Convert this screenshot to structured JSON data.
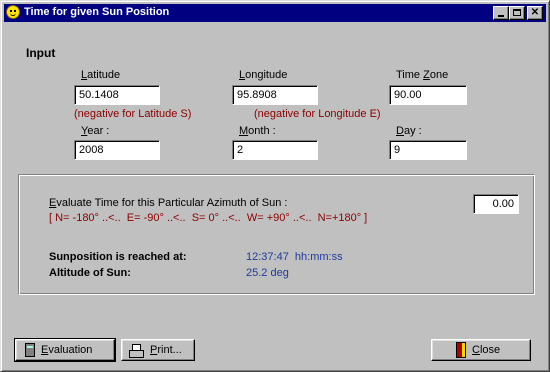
{
  "window": {
    "title": "Time for given Sun Position"
  },
  "input": {
    "heading": "Input",
    "latitude": {
      "label_mn": "L",
      "label_rest": "atitude",
      "value": "50.1408",
      "hint": "(negative for Latitude S)"
    },
    "longitude": {
      "label_mn": "L",
      "label_rest": "ongitude",
      "value": "95.8908",
      "hint": "(negative for Longitude E)"
    },
    "timezone": {
      "label_pre": "Time ",
      "label_mn": "Z",
      "label_rest": "one",
      "value": "90.00"
    },
    "year": {
      "label_mn": "Y",
      "label_rest": "ear :",
      "value": "2008"
    },
    "month": {
      "label_mn": "M",
      "label_rest": "onth :",
      "value": "2"
    },
    "day": {
      "label_mn": "D",
      "label_rest": "ay :",
      "value": "9"
    }
  },
  "azimuth": {
    "label_mn": "E",
    "label_rest": "valuate Time for this Particular Azimuth of Sun :",
    "range": "[ N= -180° ..<..  E= -90° ..<..  S= 0° ..<..  W= +90° ..<..  N=+180° ]",
    "value": "0.00"
  },
  "results": {
    "sunposition_label": "Sunposition is reached at:",
    "sunposition_value": "12:37:47  hh:mm:ss",
    "altitude_label": "Altitude of Sun:",
    "altitude_value": "25.2 deg"
  },
  "buttons": {
    "evaluation_mn": "E",
    "evaluation_rest": "valuation",
    "print_mn": "P",
    "print_rest": "rint...",
    "close_mn": "C",
    "close_rest": "lose"
  }
}
